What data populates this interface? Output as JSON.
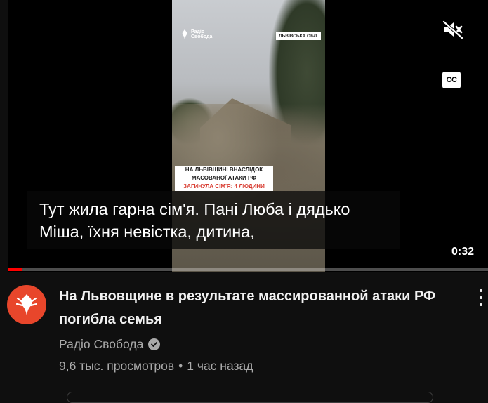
{
  "player": {
    "video": {
      "brand_logo_text": "Радіо Свобода",
      "region_label": "ЛЬВІВСЬКА ОБЛ.",
      "headline_line1": "НА ЛЬВІВЩИНІ ВНАСЛІДОК",
      "headline_line2": "МАСОВАНОЇ АТАКИ РФ",
      "headline_accent": "ЗАГИНУЛА СІМ'Я: 4 ЛЮДИНИ"
    },
    "caption_line1": "Тут жила гарна сім'я. Пані Люба і дядько",
    "caption_line2": "Міша, їхня невістка, дитина,",
    "time": "0:32",
    "cc_label": "CC",
    "mute_icon": "volume-muted-icon",
    "progress_fraction": 0.03,
    "progress_color": "#ff0000"
  },
  "video_meta": {
    "title": "На Львовщине в результате массированной атаки РФ погибла семья",
    "channel": "Радіо Свобода",
    "verified_icon": "verified-check-icon",
    "views": "9,6 тыс. просмотров",
    "separator": "•",
    "age": "1 час назад",
    "avatar_color": "#e8462b"
  }
}
